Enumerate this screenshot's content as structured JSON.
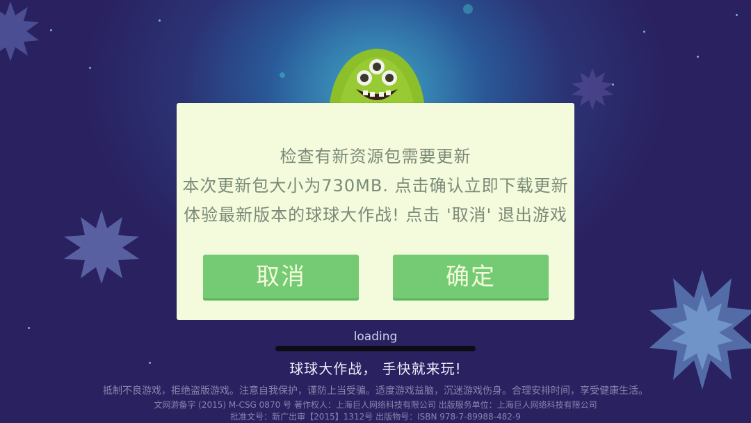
{
  "dialog": {
    "line1": "检查有新资源包需要更新",
    "line2": "本次更新包大小为730MB. 点击确认立即下载更新",
    "line3": "体验最新版本的球球大作战! 点击 '取消' 退出游戏",
    "cancel_label": "取消",
    "confirm_label": "确定"
  },
  "loading": {
    "label": "loading",
    "progress": 0
  },
  "slogan": "球球大作战，  手快就来玩!",
  "footer": {
    "notice_line": "抵制不良游戏，拒绝盗版游戏。注意自我保护，谨防上当受骗。适度游戏益脑，沉迷游戏伤身。合理安排时间，享受健康生活。",
    "publisher_line": "文网游备字 (2015) M-CSG 0870 号 著作权人：上海巨人网络科技有限公司 出版服务单位：上海巨人网络科技有限公司",
    "approval_line": "批准文号：新广出审【2015】1312号 出版物号：ISBN 978-7-89988-482-9"
  },
  "colors": {
    "dialog_bg": "#f4fbdc",
    "button_green": "#74cb74",
    "dialog_text": "#7b8a78"
  }
}
